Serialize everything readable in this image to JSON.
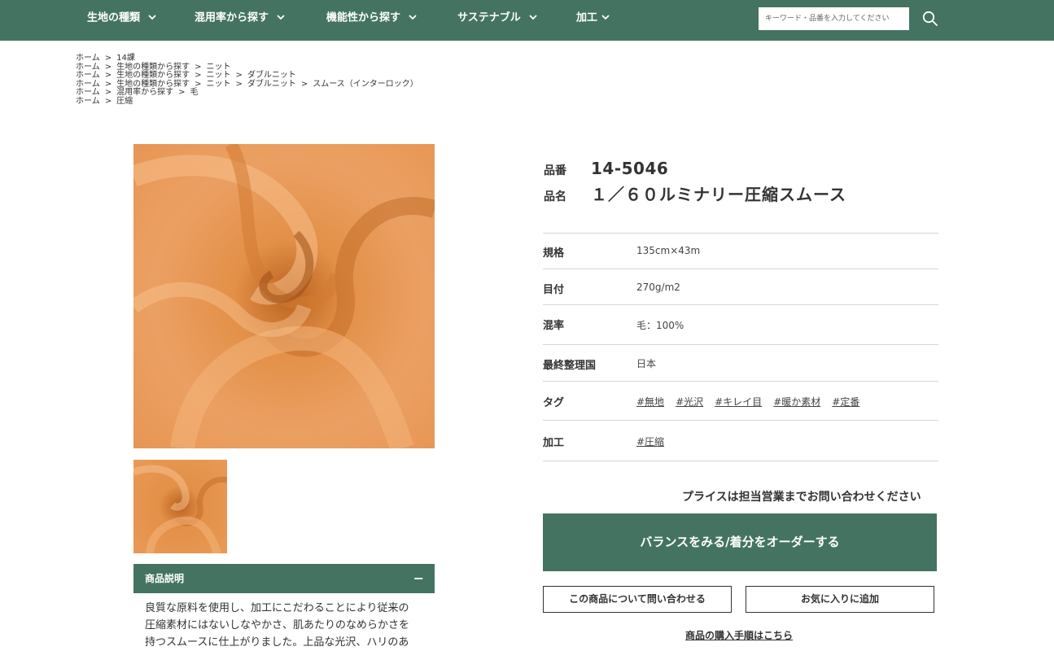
{
  "nav": {
    "items": [
      {
        "label": "生地の種類"
      },
      {
        "label": "混用率から探す"
      },
      {
        "label": "機能性から探す"
      },
      {
        "label": "サステナブル"
      },
      {
        "label": "加工"
      }
    ],
    "search_placeholder": "キーワード・品番を入力してください"
  },
  "breadcrumbs": [
    [
      "ホーム",
      "14課"
    ],
    [
      "ホーム",
      "生地の種類から探す",
      "ニット"
    ],
    [
      "ホーム",
      "生地の種類から探す",
      "ニット",
      "ダブルニット"
    ],
    [
      "ホーム",
      "生地の種類から探す",
      "ニット",
      "ダブルニット",
      "スムース（インターロック）"
    ],
    [
      "ホーム",
      "混用率から探す",
      "毛"
    ],
    [
      "ホーム",
      "圧縮"
    ]
  ],
  "product": {
    "code_label": "品番",
    "code": "14-5046",
    "name_label": "品名",
    "name": "１／６０ルミナリー圧縮スムース"
  },
  "specs": {
    "size": {
      "label": "規格",
      "value": "135cm×43m"
    },
    "weight": {
      "label": "目付",
      "value": "270g/m2"
    },
    "blend": {
      "label": "混率",
      "value": "毛：100%"
    },
    "origin": {
      "label": "最終整理国",
      "value": "日本"
    },
    "tags": {
      "label": "タグ",
      "items": [
        "#無地",
        "#光沢",
        "#キレイ目",
        "#暖か素材",
        "#定番"
      ]
    },
    "processing": {
      "label": "加工",
      "items": [
        "#圧縮"
      ]
    }
  },
  "description": {
    "title": "商品説明",
    "toggle": "−",
    "lines": [
      "良質な原料を使用し、加工にこだわることにより従来の",
      "圧縮素材にはないしなやかさ、肌あたりのなめらかさを",
      "持つスムースに仕上がりました。上品な光沢、ハリのあ"
    ]
  },
  "price_note": "プライスは担当営業までお問い合わせください",
  "buttons": {
    "order": "バランスをみる/着分をオーダーする",
    "inquire": "この商品について問い合わせる",
    "favorite": "お気に入りに追加",
    "purchase_guide": "商品の購入手順はこちら"
  },
  "colors": {
    "brand_green": "#447461",
    "fabric": "#e8964f"
  },
  "icons": {
    "nav_chevron": "chevron-down-icon",
    "search": "search-icon",
    "accordion": "minus-icon"
  }
}
